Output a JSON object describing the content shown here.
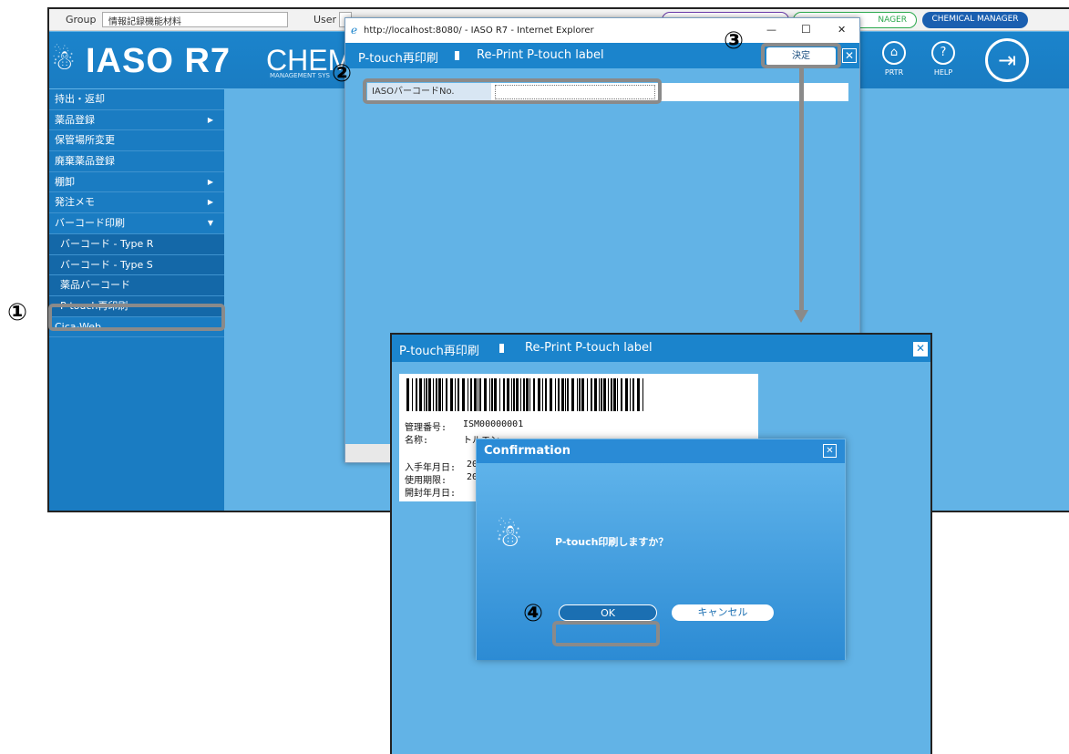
{
  "app": {
    "group_label": "Group",
    "group_value": "情報記録機能材料",
    "user_label": "User",
    "user_value": "",
    "pill_1": "",
    "pill_2": "NAGER",
    "pill_3": "CHEMICAL MANAGER",
    "logo": "IASO R7",
    "chem": "CHEM",
    "chem_sub": "MANAGEMENT SYS",
    "prtr_label": "PRTR",
    "help_label": "HELP"
  },
  "sidebar": {
    "items": [
      {
        "label": "持出・返却",
        "arrow": ""
      },
      {
        "label": "薬品登録",
        "arrow": "▶"
      },
      {
        "label": "保管場所変更",
        "arrow": ""
      },
      {
        "label": "廃棄薬品登録",
        "arrow": ""
      },
      {
        "label": "棚卸",
        "arrow": "▶"
      },
      {
        "label": "発注メモ",
        "arrow": "▶"
      },
      {
        "label": "バーコード印刷",
        "arrow": "▼"
      },
      {
        "label": "バーコード - Type R",
        "arrow": ""
      },
      {
        "label": "バーコード - Type S",
        "arrow": ""
      },
      {
        "label": "薬品バーコード",
        "arrow": ""
      },
      {
        "label": "P-touch再印刷",
        "arrow": ""
      },
      {
        "label": "Cica-Web",
        "arrow": ""
      }
    ]
  },
  "ie_window": {
    "title": "http://localhost:8080/ - IASO R7 - Internet Explorer",
    "min": "—",
    "max": "☐",
    "close": "✕",
    "bar_title_jp": "P-touch再印刷",
    "bar_title_en": "Re-Print P-touch label",
    "decide_button": "決定",
    "field_label": "IASOバーコードNo.",
    "field_value": ""
  },
  "callouts": {
    "n1": "①",
    "n2": "②",
    "n3": "③",
    "n4": "④"
  },
  "label_window": {
    "bar_title_jp": "P-touch再印刷",
    "bar_title_en": "Re-Print P-touch label",
    "kanri_label": "管理番号:",
    "kanri_value": "ISM00000001",
    "name_label": "名称:",
    "name_value": "トルエン",
    "date_in_label": "入手年月日:",
    "date_in_value": "201",
    "expiry_label": "使用期限:",
    "expiry_value": "202",
    "open_label": "開封年月日:"
  },
  "confirm": {
    "title": "Confirmation",
    "close": "✕",
    "message": "P-touch印刷しますか？",
    "ok": "OK",
    "cancel": "キャンセル"
  },
  "colors": {
    "accent": "#1b84cc",
    "body_blue": "#62b3e6",
    "callout_gray": "#8a8a8a"
  }
}
